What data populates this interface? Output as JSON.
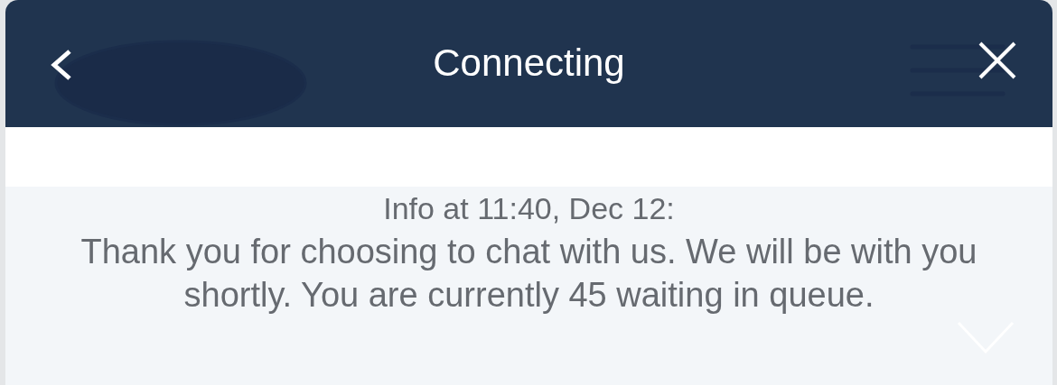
{
  "header": {
    "title": "Connecting"
  },
  "message": {
    "info": "Info at 11:40, Dec 12:",
    "text": "Thank you for choosing to chat with us. We will be with you shortly. You are currently 45 waiting in queue."
  }
}
